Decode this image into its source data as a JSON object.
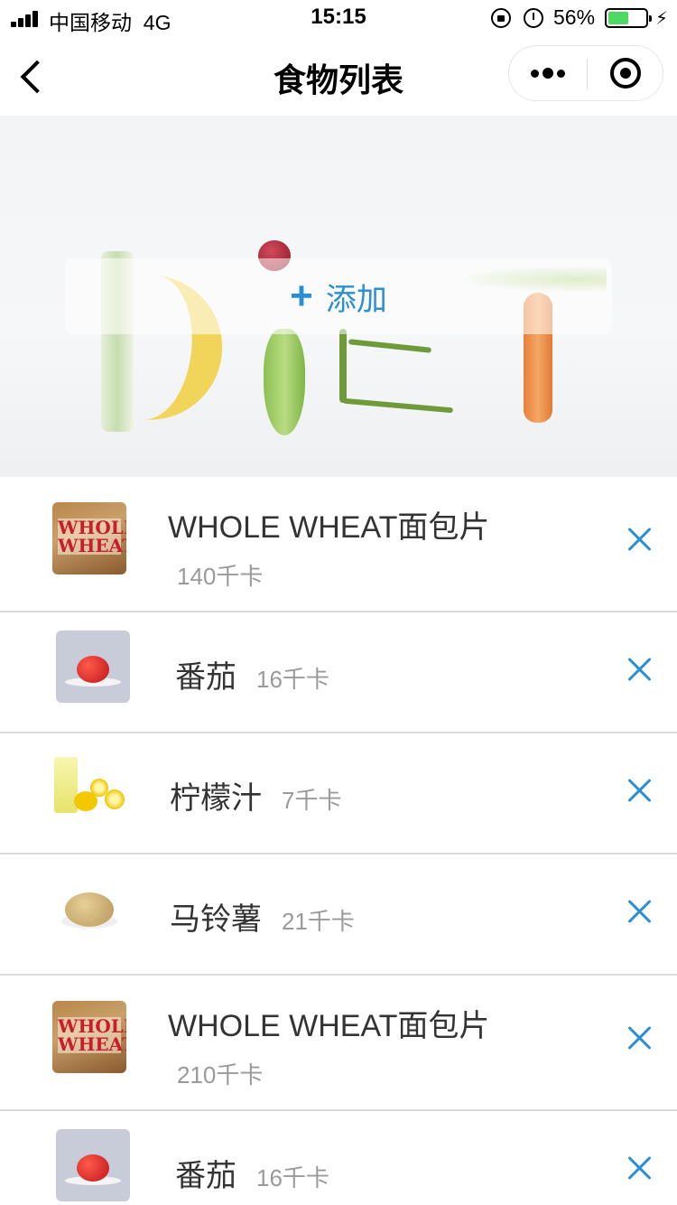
{
  "status_bar": {
    "carrier": "中国移动",
    "network": "4G",
    "time": "15:15",
    "battery_percent": "56%",
    "battery_level": 0.56
  },
  "nav": {
    "title": "食物列表"
  },
  "banner": {
    "add_label": "添加",
    "add_icon": "plus-icon"
  },
  "food_items": [
    {
      "name": "WHOLE WHEAT面包片",
      "calories": "140千卡",
      "image": "whole-wheat-bread"
    },
    {
      "name": "番茄",
      "calories": "16千卡",
      "image": "tomato"
    },
    {
      "name": "柠檬汁",
      "calories": "7千卡",
      "image": "lemon-juice"
    },
    {
      "name": "马铃薯",
      "calories": "21千卡",
      "image": "potato"
    },
    {
      "name": "WHOLE WHEAT面包片",
      "calories": "210千卡",
      "image": "whole-wheat-bread"
    },
    {
      "name": "番茄",
      "calories": "16千卡",
      "image": "tomato"
    }
  ],
  "colors": {
    "accent": "#2b8fd6",
    "divider": "#d9d9d9",
    "calorie_text": "#9a9a9a"
  }
}
